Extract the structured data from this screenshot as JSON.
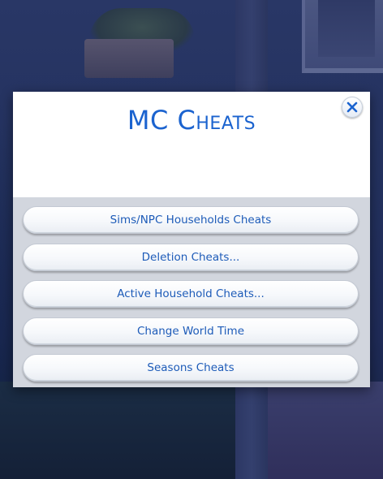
{
  "dialog": {
    "title": "MC Cheats",
    "close_icon": "close-x-icon",
    "accent_color": "#1b63cf",
    "buttons": [
      {
        "label": "Sims/NPC Households Cheats"
      },
      {
        "label": "Deletion Cheats..."
      },
      {
        "label": "Active Household Cheats..."
      },
      {
        "label": "Change World Time"
      },
      {
        "label": "Seasons Cheats"
      }
    ]
  }
}
